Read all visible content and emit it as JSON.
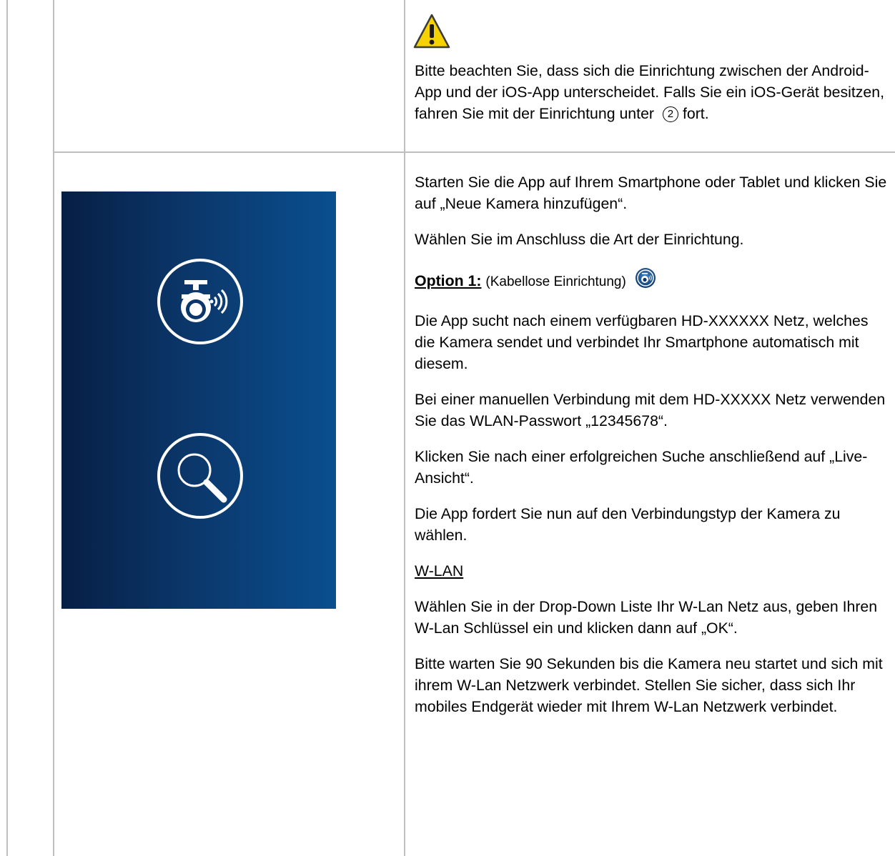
{
  "warning": {
    "icon": "warning-triangle-icon",
    "text_before": "Bitte beachten Sie, dass sich die Einrichtung zwischen der Android-App und der iOS-App unterscheidet. Falls Sie ein iOS-Gerät besitzen, fahren Sie mit der Einrichtung unter",
    "circled_number": "2",
    "text_after": "fort."
  },
  "panel": {
    "background_colors": [
      "#061f44",
      "#0a4f8f"
    ],
    "icons": [
      "wireless-camera-setup-icon",
      "search-icon"
    ]
  },
  "instructions": {
    "p1": "Starten Sie die App auf Ihrem Smartphone oder Tablet und klicken Sie auf „Neue Kamera hinzufügen“.",
    "p2": "Wählen Sie im Anschluss die Art der Einrichtung.",
    "option_label": "Option 1:",
    "option_desc": "(Kabellose Einrichtung)",
    "p3": "Die App sucht nach einem verfügbaren HD-XXXXXX Netz, welches die Kamera sendet und verbindet Ihr Smartphone automatisch mit diesem.",
    "p4": "Bei einer manuellen Verbindung mit dem HD-XXXXX Netz verwenden Sie das WLAN-Passwort „12345678“.",
    "p5": "Klicken Sie nach einer erfolgreichen Suche anschließend auf „Live-Ansicht“.",
    "p6": "Die App fordert Sie nun auf den Verbindungstyp der Kamera zu wählen.",
    "section_heading": "W-LAN",
    "p7": "Wählen Sie in der Drop-Down Liste Ihr W-Lan Netz aus, geben Ihren W-Lan Schlüssel ein und klicken dann auf „OK“.",
    "p8": "Bitte warten Sie 90 Sekunden bis die Kamera neu startet und sich mit ihrem W-Lan Netzwerk verbindet. Stellen Sie sicher, dass sich Ihr mobiles Endgerät wieder mit Ihrem W-Lan Netzwerk verbindet."
  }
}
